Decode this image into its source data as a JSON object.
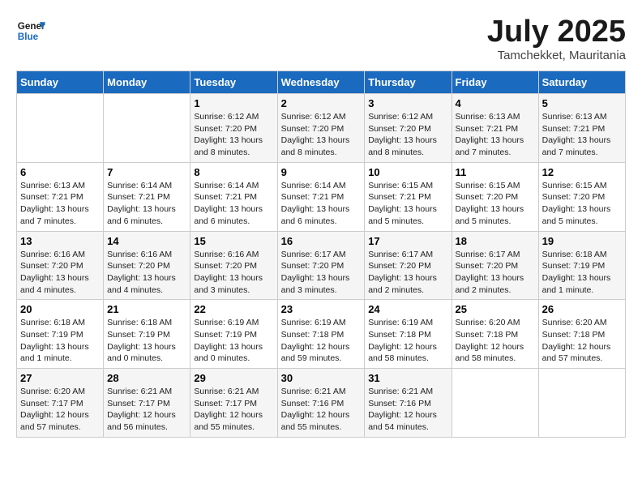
{
  "logo": {
    "line1": "General",
    "line2": "Blue"
  },
  "title": "July 2025",
  "location": "Tamchekket, Mauritania",
  "days_of_week": [
    "Sunday",
    "Monday",
    "Tuesday",
    "Wednesday",
    "Thursday",
    "Friday",
    "Saturday"
  ],
  "weeks": [
    [
      {
        "day": "",
        "info": ""
      },
      {
        "day": "",
        "info": ""
      },
      {
        "day": "1",
        "info": "Sunrise: 6:12 AM\nSunset: 7:20 PM\nDaylight: 13 hours and 8 minutes."
      },
      {
        "day": "2",
        "info": "Sunrise: 6:12 AM\nSunset: 7:20 PM\nDaylight: 13 hours and 8 minutes."
      },
      {
        "day": "3",
        "info": "Sunrise: 6:12 AM\nSunset: 7:20 PM\nDaylight: 13 hours and 8 minutes."
      },
      {
        "day": "4",
        "info": "Sunrise: 6:13 AM\nSunset: 7:21 PM\nDaylight: 13 hours and 7 minutes."
      },
      {
        "day": "5",
        "info": "Sunrise: 6:13 AM\nSunset: 7:21 PM\nDaylight: 13 hours and 7 minutes."
      }
    ],
    [
      {
        "day": "6",
        "info": "Sunrise: 6:13 AM\nSunset: 7:21 PM\nDaylight: 13 hours and 7 minutes."
      },
      {
        "day": "7",
        "info": "Sunrise: 6:14 AM\nSunset: 7:21 PM\nDaylight: 13 hours and 6 minutes."
      },
      {
        "day": "8",
        "info": "Sunrise: 6:14 AM\nSunset: 7:21 PM\nDaylight: 13 hours and 6 minutes."
      },
      {
        "day": "9",
        "info": "Sunrise: 6:14 AM\nSunset: 7:21 PM\nDaylight: 13 hours and 6 minutes."
      },
      {
        "day": "10",
        "info": "Sunrise: 6:15 AM\nSunset: 7:21 PM\nDaylight: 13 hours and 5 minutes."
      },
      {
        "day": "11",
        "info": "Sunrise: 6:15 AM\nSunset: 7:20 PM\nDaylight: 13 hours and 5 minutes."
      },
      {
        "day": "12",
        "info": "Sunrise: 6:15 AM\nSunset: 7:20 PM\nDaylight: 13 hours and 5 minutes."
      }
    ],
    [
      {
        "day": "13",
        "info": "Sunrise: 6:16 AM\nSunset: 7:20 PM\nDaylight: 13 hours and 4 minutes."
      },
      {
        "day": "14",
        "info": "Sunrise: 6:16 AM\nSunset: 7:20 PM\nDaylight: 13 hours and 4 minutes."
      },
      {
        "day": "15",
        "info": "Sunrise: 6:16 AM\nSunset: 7:20 PM\nDaylight: 13 hours and 3 minutes."
      },
      {
        "day": "16",
        "info": "Sunrise: 6:17 AM\nSunset: 7:20 PM\nDaylight: 13 hours and 3 minutes."
      },
      {
        "day": "17",
        "info": "Sunrise: 6:17 AM\nSunset: 7:20 PM\nDaylight: 13 hours and 2 minutes."
      },
      {
        "day": "18",
        "info": "Sunrise: 6:17 AM\nSunset: 7:20 PM\nDaylight: 13 hours and 2 minutes."
      },
      {
        "day": "19",
        "info": "Sunrise: 6:18 AM\nSunset: 7:19 PM\nDaylight: 13 hours and 1 minute."
      }
    ],
    [
      {
        "day": "20",
        "info": "Sunrise: 6:18 AM\nSunset: 7:19 PM\nDaylight: 13 hours and 1 minute."
      },
      {
        "day": "21",
        "info": "Sunrise: 6:18 AM\nSunset: 7:19 PM\nDaylight: 13 hours and 0 minutes."
      },
      {
        "day": "22",
        "info": "Sunrise: 6:19 AM\nSunset: 7:19 PM\nDaylight: 13 hours and 0 minutes."
      },
      {
        "day": "23",
        "info": "Sunrise: 6:19 AM\nSunset: 7:18 PM\nDaylight: 12 hours and 59 minutes."
      },
      {
        "day": "24",
        "info": "Sunrise: 6:19 AM\nSunset: 7:18 PM\nDaylight: 12 hours and 58 minutes."
      },
      {
        "day": "25",
        "info": "Sunrise: 6:20 AM\nSunset: 7:18 PM\nDaylight: 12 hours and 58 minutes."
      },
      {
        "day": "26",
        "info": "Sunrise: 6:20 AM\nSunset: 7:18 PM\nDaylight: 12 hours and 57 minutes."
      }
    ],
    [
      {
        "day": "27",
        "info": "Sunrise: 6:20 AM\nSunset: 7:17 PM\nDaylight: 12 hours and 57 minutes."
      },
      {
        "day": "28",
        "info": "Sunrise: 6:21 AM\nSunset: 7:17 PM\nDaylight: 12 hours and 56 minutes."
      },
      {
        "day": "29",
        "info": "Sunrise: 6:21 AM\nSunset: 7:17 PM\nDaylight: 12 hours and 55 minutes."
      },
      {
        "day": "30",
        "info": "Sunrise: 6:21 AM\nSunset: 7:16 PM\nDaylight: 12 hours and 55 minutes."
      },
      {
        "day": "31",
        "info": "Sunrise: 6:21 AM\nSunset: 7:16 PM\nDaylight: 12 hours and 54 minutes."
      },
      {
        "day": "",
        "info": ""
      },
      {
        "day": "",
        "info": ""
      }
    ]
  ]
}
